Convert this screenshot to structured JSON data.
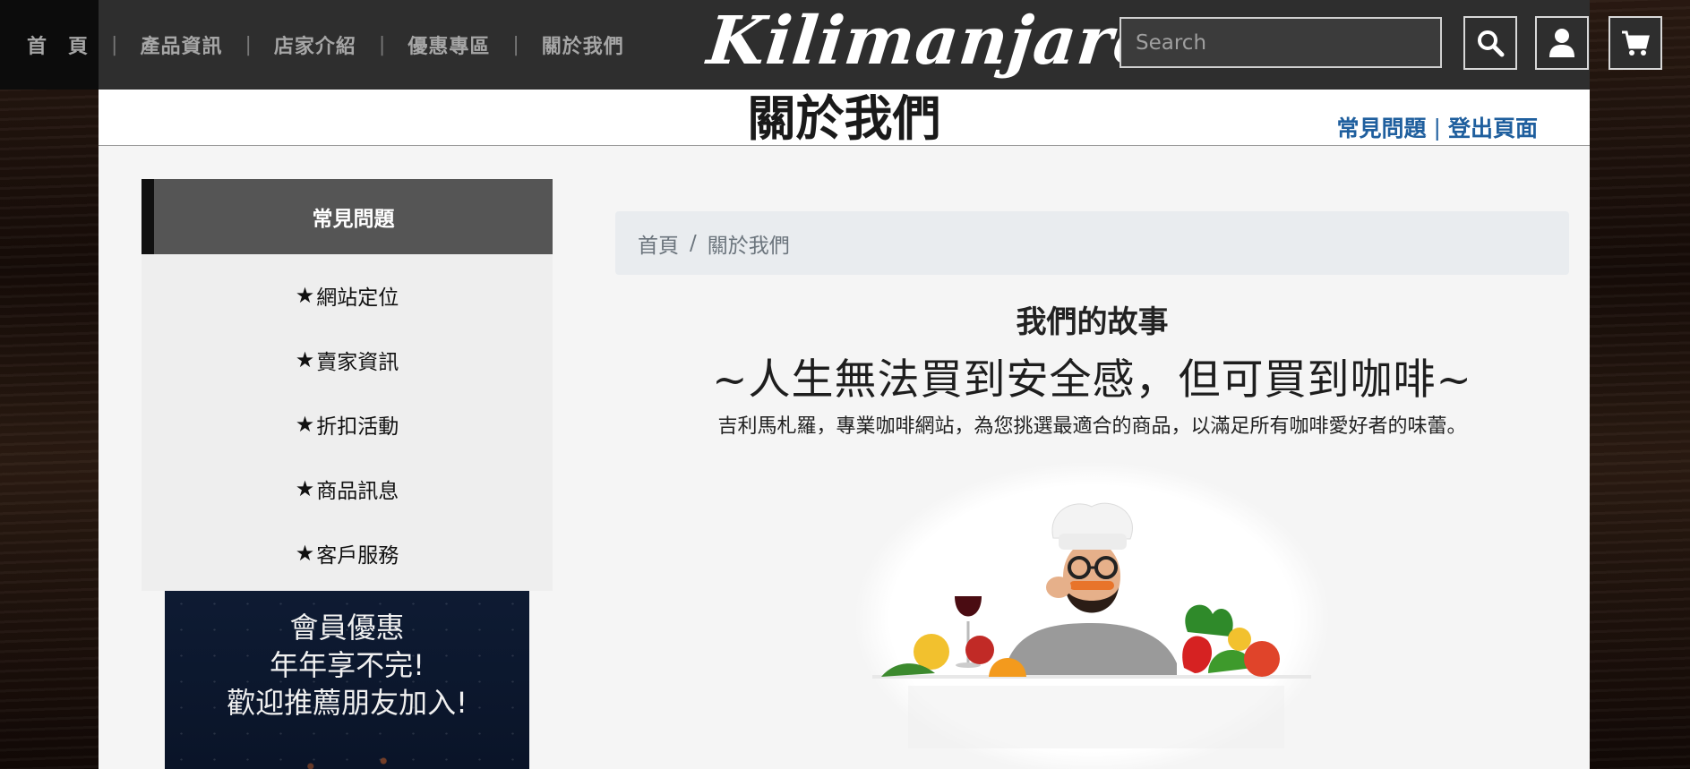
{
  "nav": {
    "items": [
      "首　頁",
      "產品資訊",
      "店家介紹",
      "優惠專區",
      "關於我們"
    ],
    "separator": "|"
  },
  "brand": {
    "logo": "Kilimanjaro"
  },
  "search": {
    "placeholder": "Search",
    "value": ""
  },
  "header_icons": [
    "search-icon",
    "user-icon",
    "cart-icon"
  ],
  "page": {
    "title": "關於我們",
    "top_links": [
      "常見問題",
      "登出頁面"
    ],
    "top_link_separator": "|"
  },
  "sidebar": {
    "heading": "常見問題",
    "star": "★",
    "items": [
      "網站定位",
      "賣家資訊",
      "折扣活動",
      "商品訊息",
      "客戶服務"
    ],
    "promo_lines": [
      "會員優惠",
      "年年享不完!",
      "歡迎推薦朋友加入!"
    ]
  },
  "breadcrumb": {
    "items": [
      "首頁",
      "關於我們"
    ],
    "separator": "/"
  },
  "content": {
    "story_title": "我們的故事",
    "slogan": "~人生無法買到安全感，但可買到咖啡~",
    "description": "吉利馬札羅，專業咖啡網站，為您挑選最適合的商品，以滿足所有咖啡愛好者的味蕾。"
  },
  "colors": {
    "topbar": "#2e2e2e",
    "link_blue": "#1f5f9e",
    "sidebar_head": "#555555",
    "breadcrumb_bg": "#e9ecef"
  }
}
